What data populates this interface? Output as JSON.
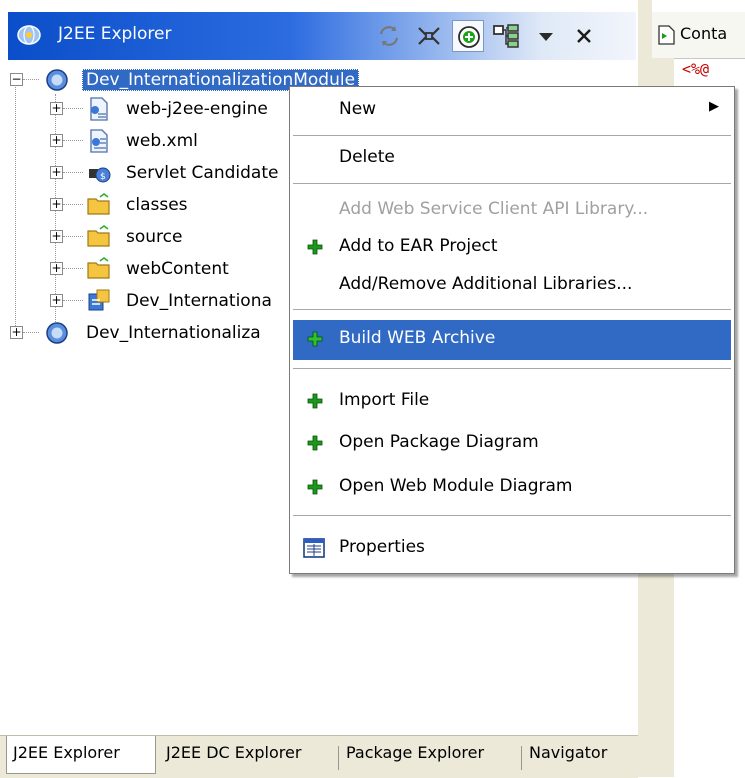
{
  "view": {
    "title": "J2EE Explorer",
    "close_glyph": "×"
  },
  "tree": {
    "root": "Dev_InternationalizationModule",
    "children": [
      "web-j2ee-engine",
      "web.xml",
      "Servlet Candidate",
      "classes",
      "source",
      "webContent",
      "Dev_Internationa"
    ],
    "second_root": "Dev_Internationaliza"
  },
  "menu": {
    "items": [
      {
        "label": "New",
        "has_submenu": true
      },
      {
        "label": "Delete"
      },
      {
        "label": "Add Web Service Client API Library...",
        "disabled": true
      },
      {
        "label": "Add to EAR Project",
        "icon": "green-plus-icon"
      },
      {
        "label": "Add/Remove Additional Libraries..."
      },
      {
        "label": "Build WEB Archive",
        "icon": "green-plus-icon",
        "highlighted": true
      },
      {
        "label": "Import File",
        "icon": "green-plus-icon"
      },
      {
        "label": "Open Package Diagram",
        "icon": "green-plus-icon"
      },
      {
        "label": "Open Web Module Diagram",
        "icon": "green-plus-icon"
      },
      {
        "label": "Properties",
        "icon": "properties-icon"
      }
    ],
    "submenu_arrow": "▶"
  },
  "tabs": [
    "J2EE Explorer",
    "J2EE DC Explorer",
    "Package Explorer",
    "Navigator"
  ],
  "right_panel": {
    "tab_label": "Conta",
    "code_fragment": "<%@"
  },
  "colors": {
    "selection": "#316ac5",
    "plus_green": "#1a9a1a",
    "title_blue": "#0a4ec9"
  }
}
